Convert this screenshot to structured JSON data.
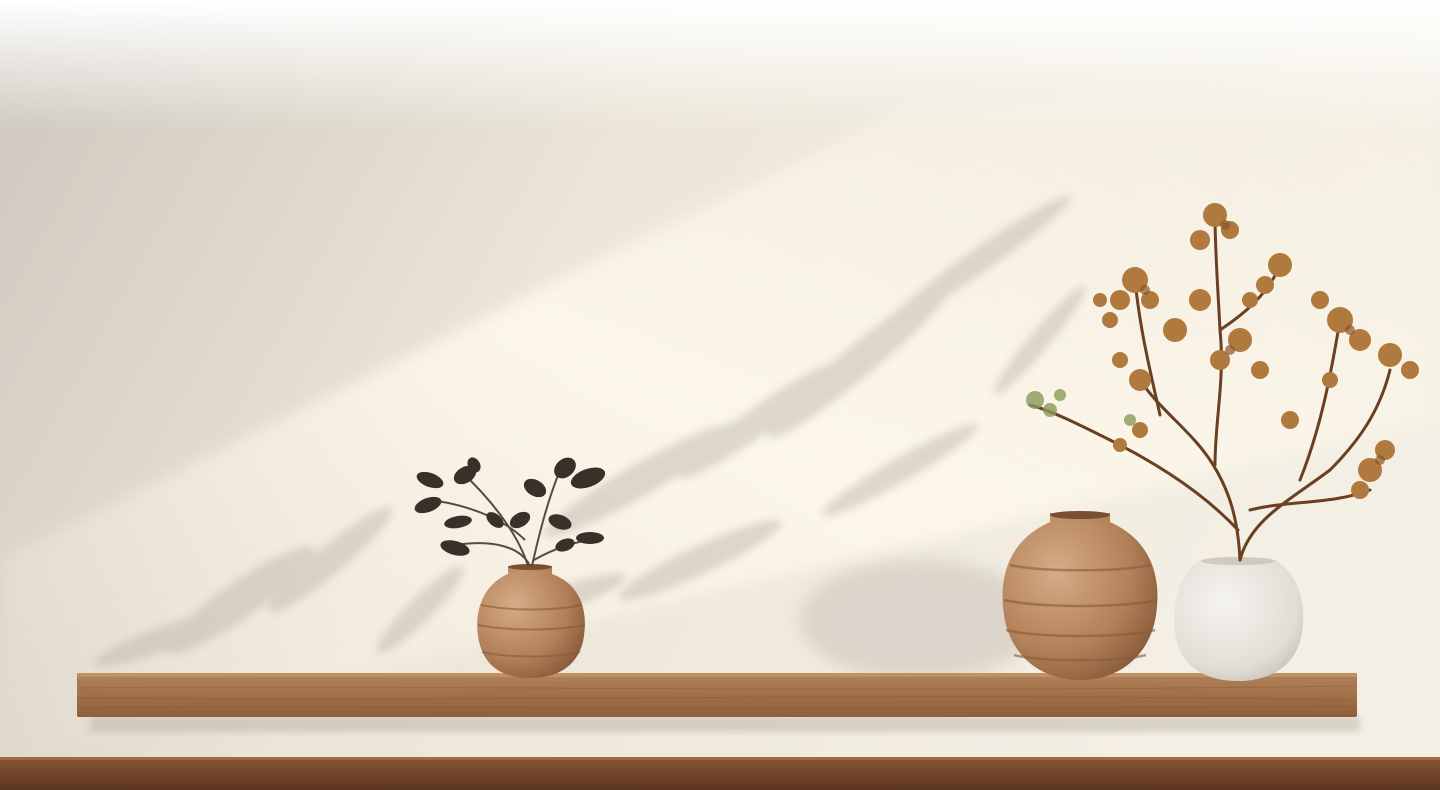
{
  "scene": {
    "description_label": "",
    "colors": {
      "wall_light": "#f6f1e4",
      "wall_shadow": "#cfc9c0",
      "wall_top_fade": "#ffffff",
      "shelf_top": "#a8764c",
      "shelf_front": "#8a5a34",
      "table": "#7a4a2a",
      "vase_wood": "#b98a63",
      "vase_wood_dark": "#8c5c3a",
      "vase_white": "#e6e2dc",
      "leaf_dark": "#3a2e28",
      "branch": "#6a3f22",
      "dry_leaf": "#b07a3e"
    },
    "objects": [
      {
        "name": "small-wooden-vase",
        "kind": "vase",
        "material": "wood"
      },
      {
        "name": "large-wooden-vase",
        "kind": "vase",
        "material": "wood"
      },
      {
        "name": "white-ceramic-vase",
        "kind": "vase",
        "material": "ceramic"
      },
      {
        "name": "eucalyptus-sprig",
        "kind": "plant"
      },
      {
        "name": "dried-branch-arrangement",
        "kind": "plant"
      },
      {
        "name": "floating-wooden-shelf",
        "kind": "shelf"
      },
      {
        "name": "wooden-tabletop",
        "kind": "surface"
      }
    ]
  }
}
